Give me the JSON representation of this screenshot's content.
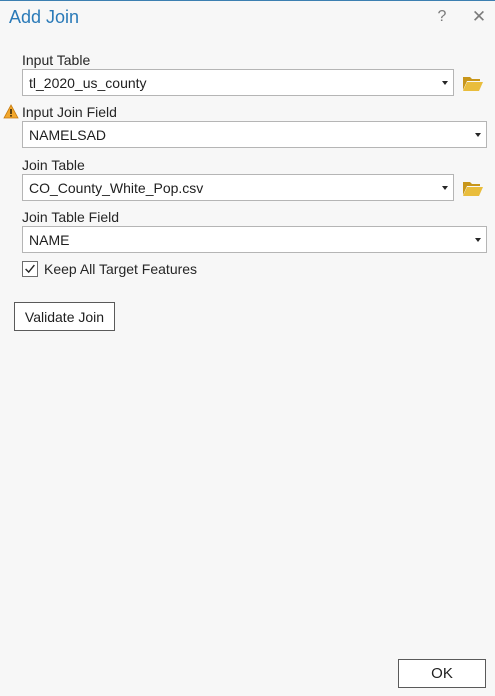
{
  "dialog": {
    "title": "Add Join",
    "help_label": "?",
    "close_label": "✕"
  },
  "fields": {
    "input_table": {
      "label": "Input Table",
      "value": "tl_2020_us_county"
    },
    "input_join_field": {
      "label": "Input Join Field",
      "value": "NAMELSAD"
    },
    "join_table": {
      "label": "Join Table",
      "value": "CO_County_White_Pop.csv"
    },
    "join_table_field": {
      "label": "Join Table Field",
      "value": "NAME"
    }
  },
  "keep_all": {
    "label": "Keep All Target Features",
    "checked": true
  },
  "buttons": {
    "validate_label": "Validate Join",
    "ok_label": "OK"
  },
  "icons": {
    "warning": "warning-icon",
    "browse": "folder-open-icon"
  },
  "colors": {
    "title": "#2a7ab8",
    "folder": "#d6a61c",
    "warning": "#f0a92a"
  }
}
